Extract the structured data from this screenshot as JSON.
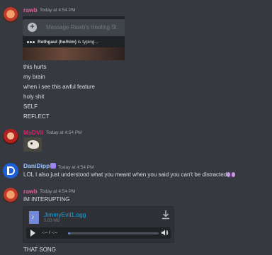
{
  "messages": [
    {
      "username": "rawb",
      "username_color": "#e45d9a",
      "timestamp": "Today at 4:54 PM",
      "embed": {
        "input_placeholder": "Message Rawb's Healing St",
        "typing_user": "Rethgaul (he/him)",
        "typing_suffix": " is typing..."
      },
      "lines": [
        "this hurts",
        "my brain",
        "when i see this awful feature",
        "holy shit",
        "SELF",
        "REFLECT"
      ]
    },
    {
      "username": "MsDVil",
      "username_color": "#e91e63",
      "timestamp": "Today at 4:54 PM"
    },
    {
      "username": "DaniDipp",
      "username_color": "#9cc3ff",
      "timestamp": "Today at 4:54 PM",
      "lines": [
        "LOL I also just understood what you meant when you said you can't be distracted"
      ]
    },
    {
      "username": "rawb",
      "username_color": "#e45d9a",
      "timestamp": "Today at 4:54 PM",
      "lines": [
        "IM INTERUPTING"
      ],
      "attachment": {
        "filename": "JimmyEvil1.ogg",
        "size": "5.63 MB",
        "time": "-:-- / -:--",
        "progress": 0.0
      },
      "after_lines": [
        "THAT SONG"
      ]
    }
  ]
}
